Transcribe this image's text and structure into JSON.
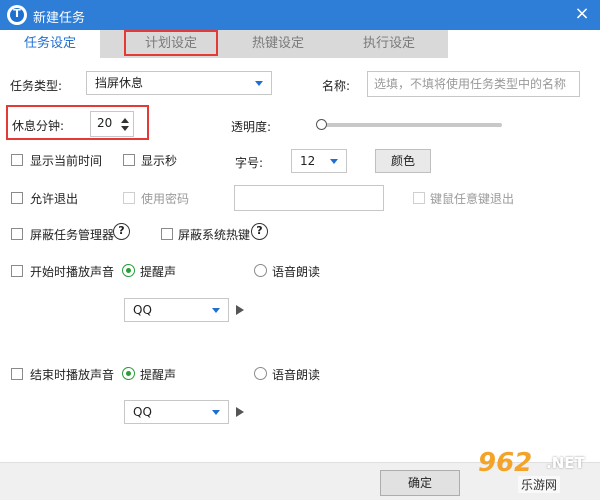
{
  "window": {
    "title": "新建任务",
    "close_label": "×",
    "accent": "#2e7dd7"
  },
  "tabs": [
    {
      "label": "任务设定",
      "active": true
    },
    {
      "label": "计划设定",
      "active": false
    },
    {
      "label": "热键设定",
      "active": false
    },
    {
      "label": "执行设定",
      "active": false
    }
  ],
  "form": {
    "task_type_label": "任务类型:",
    "task_type_value": "挡屏休息",
    "name_label": "名称:",
    "name_placeholder": "选填，不填将使用任务类型中的名称",
    "minutes_label": "休息分钟:",
    "minutes_value": "20",
    "opacity_label": "透明度:",
    "opacity_level": 0,
    "show_time_label": "显示当前时间",
    "show_seconds_label": "显示秒",
    "font_size_label": "字号:",
    "font_size_value": "12",
    "color_button": "颜色",
    "allow_exit_label": "允许退出",
    "use_password_label": "使用密码",
    "password_value": "",
    "any_key_exit_label": "键鼠任意键退出",
    "block_taskmgr_label": "屏蔽任务管理器",
    "block_hotkeys_label": "屏蔽系统热键",
    "help_glyph": "?",
    "start_sound_label": "开始时播放声音",
    "end_sound_label": "结束时播放声音",
    "reminder_label": "提醒声",
    "voice_label": "语音朗读",
    "start_sound_value": "QQ",
    "end_sound_value": "QQ"
  },
  "footer": {
    "ok_label": "确定"
  },
  "watermark": {
    "brand": "962",
    "net": ".NET",
    "site": "乐游网"
  }
}
